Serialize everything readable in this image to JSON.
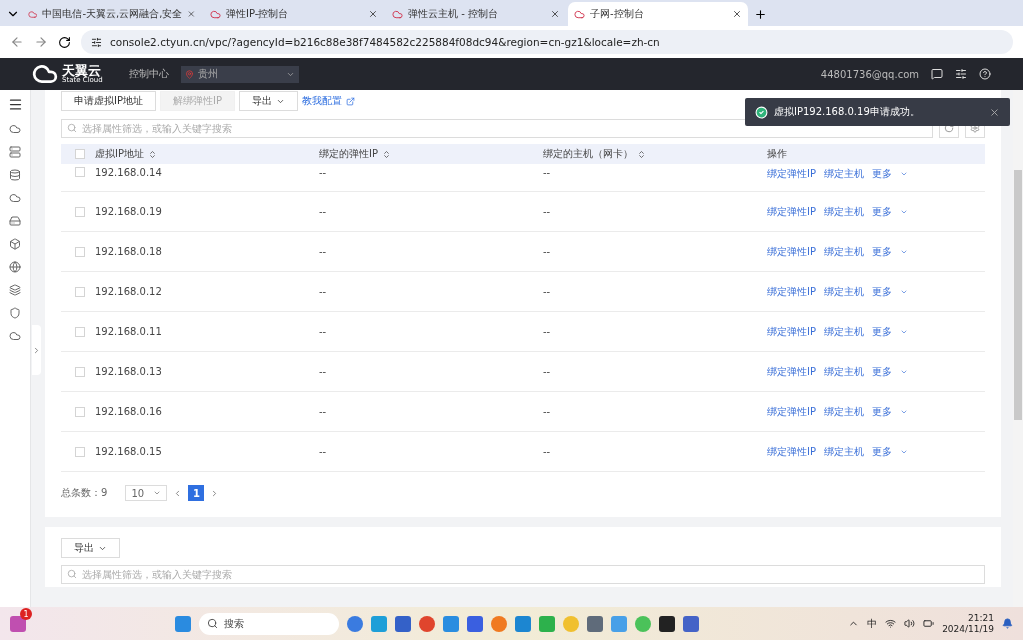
{
  "browser": {
    "tabs": [
      {
        "title": "中国电信-天翼云,云网融合,安全",
        "selected": false
      },
      {
        "title": "弹性IP-控制台",
        "selected": false
      },
      {
        "title": "弹性云主机 - 控制台",
        "selected": false
      },
      {
        "title": "子网-控制台",
        "selected": true
      }
    ],
    "url": "console2.ctyun.cn/vpc/?agencyId=b216c88e38f7484582c225884f08dc94&region=cn-gz1&locale=zh-cn"
  },
  "header": {
    "logo_name": "天翼云",
    "logo_sub": "State Cloud",
    "nav": "控制中心",
    "region": "贵州",
    "account": "44801736@qq.com"
  },
  "toolbar": {
    "buttons": [
      {
        "label": "申请虚拟IP地址",
        "disabled": false
      },
      {
        "label": "解绑弹性IP",
        "disabled": true
      }
    ],
    "export": "导出",
    "help_link": "教我配置"
  },
  "search": {
    "placeholder": "选择属性筛选，或输入关键字搜索"
  },
  "table": {
    "select_all_checked": false,
    "columns": [
      {
        "label": "虚拟IP地址",
        "sortable": true
      },
      {
        "label": "绑定的弹性IP",
        "sortable": true
      },
      {
        "label": "绑定的主机（网卡）",
        "sortable": true
      },
      {
        "label": "操作",
        "sortable": false
      }
    ],
    "rows": [
      {
        "ip": "192.168.0.14",
        "eip": "--",
        "host": "--",
        "actions": [
          "绑定弹性IP",
          "绑定主机",
          "更多"
        ],
        "selected": false
      },
      {
        "ip": "192.168.0.19",
        "eip": "--",
        "host": "--",
        "actions": [
          "绑定弹性IP",
          "绑定主机",
          "更多"
        ],
        "selected": false
      },
      {
        "ip": "192.168.0.18",
        "eip": "--",
        "host": "--",
        "actions": [
          "绑定弹性IP",
          "绑定主机",
          "更多"
        ],
        "selected": false
      },
      {
        "ip": "192.168.0.12",
        "eip": "--",
        "host": "--",
        "actions": [
          "绑定弹性IP",
          "绑定主机",
          "更多"
        ],
        "selected": false
      },
      {
        "ip": "192.168.0.11",
        "eip": "--",
        "host": "--",
        "actions": [
          "绑定弹性IP",
          "绑定主机",
          "更多"
        ],
        "selected": false
      },
      {
        "ip": "192.168.0.13",
        "eip": "--",
        "host": "--",
        "actions": [
          "绑定弹性IP",
          "绑定主机",
          "更多"
        ],
        "selected": false
      },
      {
        "ip": "192.168.0.16",
        "eip": "--",
        "host": "--",
        "actions": [
          "绑定弹性IP",
          "绑定主机",
          "更多"
        ],
        "selected": false
      },
      {
        "ip": "192.168.0.15",
        "eip": "--",
        "host": "--",
        "actions": [
          "绑定弹性IP",
          "绑定主机",
          "更多"
        ],
        "selected": false
      }
    ]
  },
  "pagination": {
    "total_label": "总条数：",
    "total": "9",
    "page_size": "10",
    "pages": [
      {
        "label": "1",
        "selected": true
      }
    ]
  },
  "second_panel": {
    "export": "导出",
    "search_placeholder": "选择属性筛选，或输入关键字搜索"
  },
  "toast": {
    "message": "虚拟IP192.168.0.19申请成功。"
  },
  "taskbar": {
    "badge": "1",
    "search": "搜索",
    "ime": "中",
    "time": "21:21",
    "date": "2024/11/19"
  }
}
